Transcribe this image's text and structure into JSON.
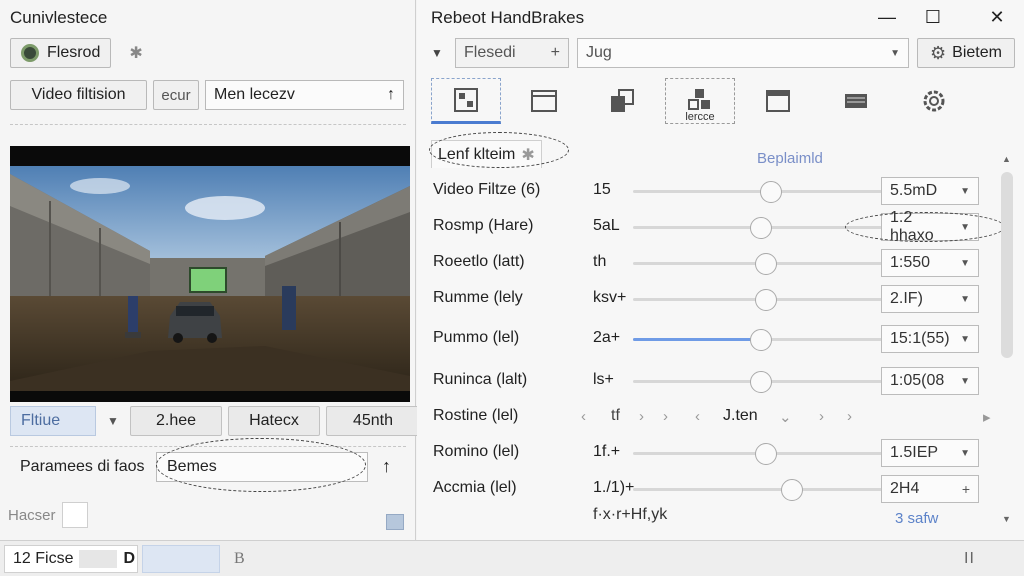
{
  "left": {
    "title": "Cunivlestece",
    "presets_label": "Flesrod",
    "video_filter_label": "Video filtision",
    "ecur_label": "ecur",
    "mode_field": "Men lecezv",
    "filter_select": "Fltiue",
    "tags": [
      "2.hee",
      "Hatecx",
      "45nth"
    ],
    "params_label": "Paramees di faos",
    "params_value": "Bemes",
    "haser_label": "Hacser"
  },
  "right": {
    "title": "Rebeot HandBrakes",
    "preset_select": "Flesedi",
    "preset_add": "+",
    "jug_field": "Jug",
    "bietem_label": "Bietem",
    "icon_tooltip": "lercce",
    "tab_label": "Lenf klteim",
    "sub_label": "Beplaimld",
    "rows": [
      {
        "name": "Video Filtze (6)",
        "val": "15",
        "knob": 0.54,
        "fill": 0,
        "select": "5.5mD"
      },
      {
        "name": "Rosmp (Hare)",
        "val": "5aL",
        "knob": 0.5,
        "fill": 0,
        "select": "1.2 hhaxo"
      },
      {
        "name": "Roeetlo (latt)",
        "val": "th",
        "knob": 0.52,
        "fill": 0,
        "select": "1:550"
      },
      {
        "name": "Rumme (lely",
        "val": "ksv+",
        "knob": 0.52,
        "fill": 0,
        "select": "2.IF)"
      },
      {
        "name": "Pummo (lel)",
        "val": "2a+",
        "knob": 0.5,
        "fill": 0.5,
        "select": "15:1(55)"
      },
      {
        "name": "Runinca (lalt)",
        "val": "ls+",
        "knob": 0.5,
        "fill": 0,
        "select": "1:05(08"
      },
      {
        "name": "Romino (lel)",
        "val": "1f.+",
        "knob": 0.52,
        "fill": 0,
        "select": "1.5IEP"
      },
      {
        "name": "Accmia (lel)",
        "val": "1./1)+",
        "knob": 0.62,
        "fill": 0,
        "select": "2H4"
      }
    ],
    "nav_row": {
      "name": "Rostine (lel)",
      "val": "tf",
      "center": "J.ten"
    },
    "footer_hint": "f·x·r+Hf,yk",
    "footer_link": "3 safw"
  },
  "status": {
    "field": "12 Ficse",
    "field_suffix": "D",
    "b_label": "B",
    "pause_label": "II"
  }
}
